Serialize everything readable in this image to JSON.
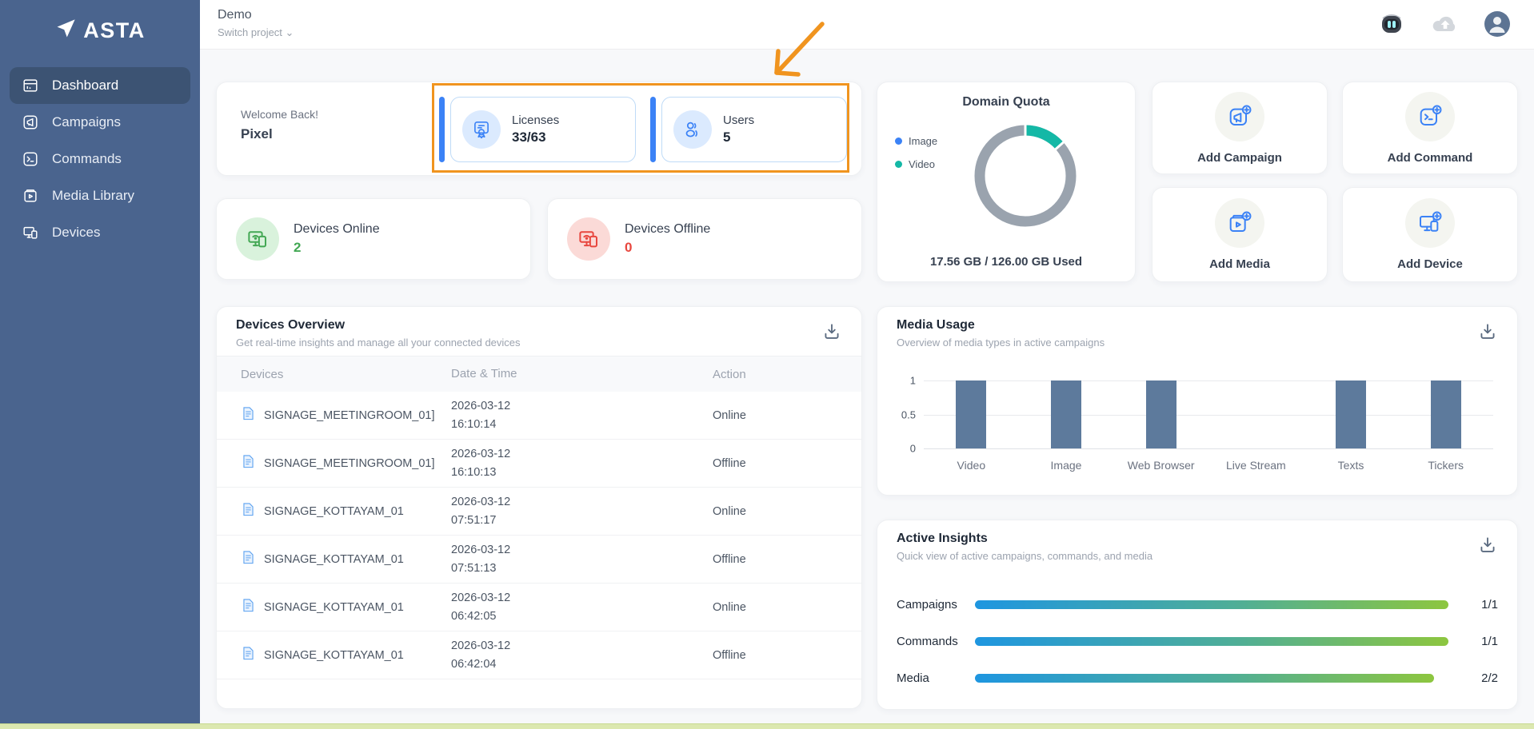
{
  "app": {
    "name": "ASTA"
  },
  "header": {
    "project_name": "Demo",
    "switch_project_label": "Switch project ⌄",
    "icons": [
      "bot-icon",
      "cloud-upload-icon",
      "user-avatar"
    ]
  },
  "sidebar": {
    "items": [
      {
        "label": "Dashboard",
        "icon": "dashboard-icon",
        "active": true
      },
      {
        "label": "Campaigns",
        "icon": "campaigns-icon",
        "active": false
      },
      {
        "label": "Commands",
        "icon": "commands-icon",
        "active": false
      },
      {
        "label": "Media Library",
        "icon": "media-library-icon",
        "active": false
      },
      {
        "label": "Devices",
        "icon": "devices-icon",
        "active": false
      }
    ]
  },
  "welcome": {
    "greeting": "Welcome Back!",
    "user_name": "Pixel"
  },
  "license_stat": {
    "label": "Licenses",
    "value": "33/63"
  },
  "users_stat": {
    "label": "Users",
    "value": "5"
  },
  "devices_online": {
    "label": "Devices Online",
    "value": "2",
    "color": "#43a854"
  },
  "devices_offline": {
    "label": "Devices Offline",
    "value": "0",
    "color": "#e8473f"
  },
  "domain_quota": {
    "title": "Domain Quota",
    "usage_text": "17.56 GB / 126.00 GB Used",
    "chart_data": {
      "type": "donut",
      "legend": [
        {
          "label": "Image",
          "color": "#3b82f6"
        },
        {
          "label": "Video",
          "color": "#14b8a6"
        }
      ],
      "segments": [
        {
          "name": "Video",
          "pct": 13.5,
          "color": "#14b8a6"
        },
        {
          "name": "Free",
          "pct": 86.5,
          "color": "#9aa3ae"
        }
      ],
      "used_gb": 17.56,
      "total_gb": 126.0
    }
  },
  "quick_actions": [
    {
      "label": "Add Campaign",
      "icon": "add-campaign-icon"
    },
    {
      "label": "Add Command",
      "icon": "add-command-icon"
    },
    {
      "label": "Add Media",
      "icon": "add-media-icon"
    },
    {
      "label": "Add Device",
      "icon": "add-device-icon"
    }
  ],
  "devices_overview": {
    "title": "Devices Overview",
    "subtitle": "Get real-time insights and manage all your connected devices",
    "columns": [
      "Devices",
      "Date & Time",
      "Action"
    ],
    "rows": [
      {
        "name": "SIGNAGE_MEETINGROOM_01]",
        "date": "2026-03-12",
        "time": "16:10:14",
        "status": "Online"
      },
      {
        "name": "SIGNAGE_MEETINGROOM_01]",
        "date": "2026-03-12",
        "time": "16:10:13",
        "status": "Offline"
      },
      {
        "name": "SIGNAGE_KOTTAYAM_01",
        "date": "2026-03-12",
        "time": "07:51:17",
        "status": "Online"
      },
      {
        "name": "SIGNAGE_KOTTAYAM_01",
        "date": "2026-03-12",
        "time": "07:51:13",
        "status": "Offline"
      },
      {
        "name": "SIGNAGE_KOTTAYAM_01",
        "date": "2026-03-12",
        "time": "06:42:05",
        "status": "Online"
      },
      {
        "name": "SIGNAGE_KOTTAYAM_01",
        "date": "2026-03-12",
        "time": "06:42:04",
        "status": "Offline"
      }
    ]
  },
  "media_usage": {
    "title": "Media Usage",
    "subtitle": "Overview of media types in active campaigns",
    "chart_data": {
      "type": "bar",
      "categories": [
        "Video",
        "Image",
        "Web Browser",
        "Live Stream",
        "Texts",
        "Tickers"
      ],
      "values": [
        1,
        1,
        1,
        0,
        1,
        1
      ],
      "yticks": [
        0,
        0.5,
        1
      ],
      "ylim": [
        0,
        1
      ],
      "bar_color": "#5d7a9c",
      "grid": true
    }
  },
  "active_insights": {
    "title": "Active Insights",
    "subtitle": "Quick view of active campaigns, commands, and media",
    "rows": [
      {
        "label": "Campaigns",
        "value": "1/1",
        "pct": 100
      },
      {
        "label": "Commands",
        "value": "1/1",
        "pct": 100
      },
      {
        "label": "Media",
        "value": "2/2",
        "pct": 97
      }
    ],
    "bar_gradient": [
      "#1e96e0",
      "#8dc63f"
    ]
  },
  "annotation": {
    "highlight_color": "#f0941f"
  }
}
